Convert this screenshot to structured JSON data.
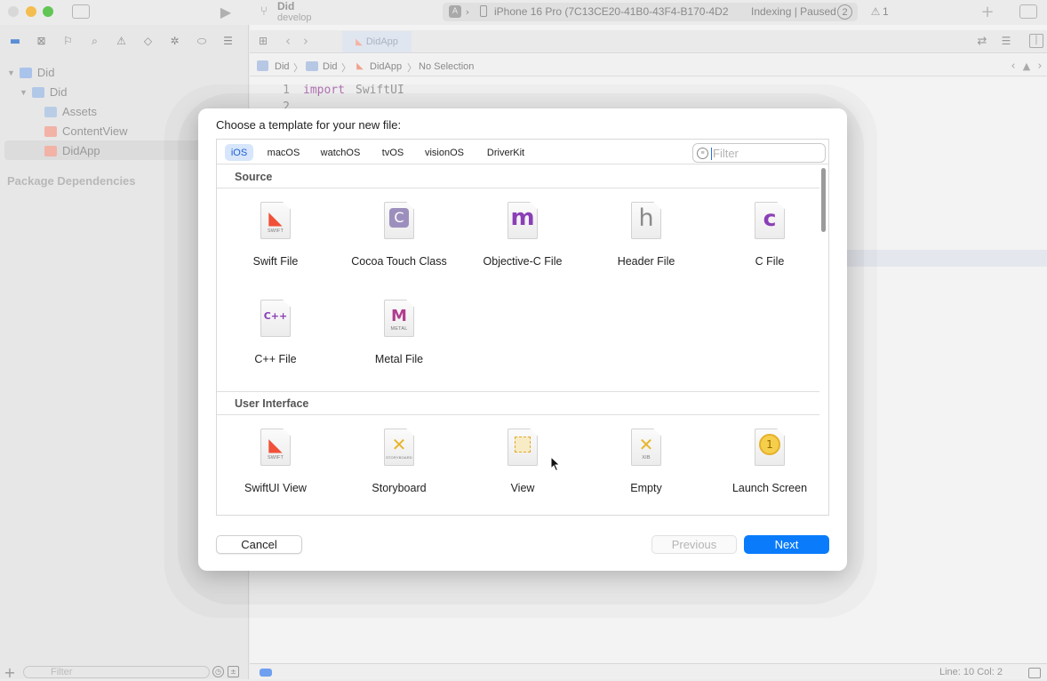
{
  "toolbar": {
    "project_name": "Did",
    "branch": "develop",
    "destination": "iPhone 16 Pro (7C13CE20-41B0-43F4-B170-4D2",
    "status": "Indexing | Paused",
    "status_count": "2",
    "warning_count": "1"
  },
  "navigator": {
    "items": [
      {
        "label": "Did"
      },
      {
        "label": "Did"
      },
      {
        "label": "Assets"
      },
      {
        "label": "ContentView"
      },
      {
        "label": "DidApp"
      }
    ],
    "package_dependencies": "Package Dependencies",
    "filter_placeholder": "Filter"
  },
  "editor": {
    "tab_label": "DidApp",
    "jump_bar": [
      "Did",
      "Did",
      "DidApp",
      "No Selection"
    ],
    "line_numbers": [
      "1",
      "2"
    ],
    "code_keyword": "import",
    "code_ident": "SwiftUI",
    "status": "Line: 10  Col: 2"
  },
  "sheet": {
    "title": "Choose a template for your new file:",
    "platform_tabs": [
      "iOS",
      "macOS",
      "watchOS",
      "tvOS",
      "visionOS",
      "DriverKit"
    ],
    "active_tab": "iOS",
    "filter_placeholder": "Filter",
    "sections": [
      {
        "title": "Source",
        "templates": [
          {
            "label": "Swift File",
            "glyph": "swift",
            "sub": "SWIFT"
          },
          {
            "label": "Cocoa Touch Class",
            "glyph": "C",
            "sub": ""
          },
          {
            "label": "Objective-C File",
            "glyph": "m",
            "sub": ""
          },
          {
            "label": "Header File",
            "glyph": "h",
            "sub": ""
          },
          {
            "label": "C File",
            "glyph": "c",
            "sub": ""
          },
          {
            "label": "C++ File",
            "glyph": "C++",
            "sub": ""
          },
          {
            "label": "Metal File",
            "glyph": "M",
            "sub": "METAL"
          }
        ]
      },
      {
        "title": "User Interface",
        "templates": [
          {
            "label": "SwiftUI View",
            "glyph": "swift",
            "sub": "SWIFT"
          },
          {
            "label": "Storyboard",
            "glyph": "storyboard",
            "sub": "STORYBOARD"
          },
          {
            "label": "View",
            "glyph": "view",
            "sub": ""
          },
          {
            "label": "Empty",
            "glyph": "xib",
            "sub": "XIB"
          },
          {
            "label": "Launch Screen",
            "glyph": "launch",
            "sub": ""
          }
        ]
      }
    ],
    "buttons": {
      "cancel": "Cancel",
      "previous": "Previous",
      "next": "Next"
    }
  },
  "colors": {
    "accent": "#0a7cfb",
    "swift": "#f05138",
    "purple": "#8a3fb6"
  }
}
